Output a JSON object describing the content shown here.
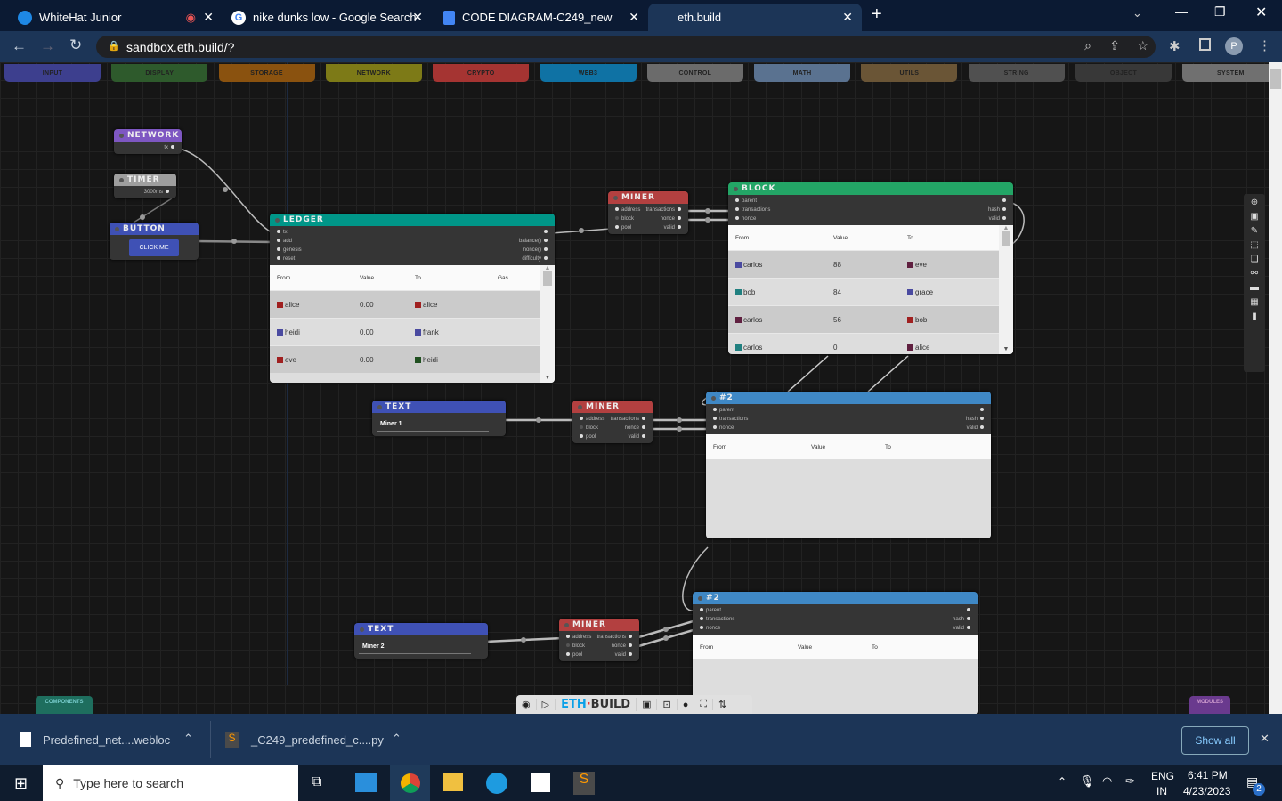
{
  "browser": {
    "tabs": [
      {
        "title": "WhiteHat Junior",
        "icon": "whitehat-icon"
      },
      {
        "title": "nike dunks low - Google Search",
        "icon": "google-icon"
      },
      {
        "title": "CODE DIAGRAM-C249_new",
        "icon": "docs-icon"
      },
      {
        "title": "eth.build",
        "icon": "none"
      }
    ],
    "url": "sandbox.eth.build/?",
    "profile": "P"
  },
  "categories": [
    {
      "label": "INPUT",
      "color": "#3d3f8e"
    },
    {
      "label": "DISPLAY",
      "color": "#2e5a2c"
    },
    {
      "label": "STORAGE",
      "color": "#8a520f"
    },
    {
      "label": "NETWORK",
      "color": "#7d7a17"
    },
    {
      "label": "CRYPTO",
      "color": "#a53432"
    },
    {
      "label": "WEB3",
      "color": "#0f72a4"
    },
    {
      "label": "CONTROL",
      "color": "#6b6b6b"
    },
    {
      "label": "MATH",
      "color": "#5a7290"
    },
    {
      "label": "UTILS",
      "color": "#6a5536"
    },
    {
      "label": "STRING",
      "color": "#505050"
    },
    {
      "label": "OBJECT",
      "color": "#383838"
    },
    {
      "label": "SYSTEM",
      "color": "#707070"
    }
  ],
  "nodes": {
    "network": {
      "title": "NETWORK",
      "color": "#7e57c2",
      "outputs": [
        "tx"
      ]
    },
    "timer": {
      "title": "TIMER",
      "color": "#9e9e9e",
      "outputs": [
        "3000ms"
      ]
    },
    "button": {
      "title": "BUTTON",
      "color": "#3f51b5",
      "button_label": "CLICK ME"
    },
    "ledger": {
      "title": "LEDGER",
      "color": "#009688",
      "inputs": [
        "tx",
        "add",
        "genesis",
        "reset"
      ],
      "outputs": [
        "",
        "balance()",
        "nonce()",
        "difficulty"
      ],
      "columns": [
        "From",
        "Value",
        "To",
        "Gas"
      ],
      "rows": [
        [
          "alice",
          "0.00",
          "alice",
          ""
        ],
        [
          "heidi",
          "0.00",
          "frank",
          ""
        ],
        [
          "eve",
          "0.00",
          "heidi",
          ""
        ]
      ]
    },
    "miner1": {
      "title": "MINER",
      "color": "#b34040",
      "inputs": [
        "address",
        "block",
        "pool"
      ],
      "outputs": [
        "transactions",
        "nonce",
        "valid"
      ]
    },
    "block": {
      "title": "BLOCK",
      "color": "#23a566",
      "inputs": [
        "parent",
        "transactions",
        "nonce"
      ],
      "outputs": [
        "",
        "hash",
        "valid"
      ],
      "columns": [
        "From",
        "Value",
        "To"
      ],
      "rows": [
        [
          "carlos",
          "88",
          "eve"
        ],
        [
          "bob",
          "84",
          "grace"
        ],
        [
          "carlos",
          "56",
          "bob"
        ],
        [
          "carlos",
          "0",
          "alice"
        ]
      ]
    },
    "text1": {
      "title": "TEXT",
      "color": "#3f51b5",
      "value": "Miner 1"
    },
    "miner2": {
      "title": "MINER",
      "color": "#b34040",
      "inputs": [
        "address",
        "block",
        "pool"
      ],
      "outputs": [
        "transactions",
        "nonce",
        "valid"
      ]
    },
    "block2": {
      "title": "#2",
      "color": "#3f88c5",
      "inputs": [
        "parent",
        "transactions",
        "nonce"
      ],
      "outputs": [
        "",
        "hash",
        "valid"
      ],
      "columns": [
        "From",
        "Value",
        "To"
      ],
      "rows": []
    },
    "text2": {
      "title": "TEXT",
      "color": "#3f51b5",
      "value": "Miner 2"
    },
    "miner3": {
      "title": "MINER",
      "color": "#b34040",
      "inputs": [
        "address",
        "block",
        "pool"
      ],
      "outputs": [
        "transactions",
        "nonce",
        "valid"
      ]
    },
    "block3": {
      "title": "#2",
      "color": "#3f88c5",
      "inputs": [
        "parent",
        "transactions",
        "nonce"
      ],
      "outputs": [
        "",
        "hash",
        "valid"
      ],
      "columns": [
        "From",
        "Value",
        "To"
      ],
      "rows": []
    }
  },
  "bottom": {
    "components": "COMPONENTS",
    "modules": "MODULES",
    "logo_eth": "ETH",
    "logo_build": "BUILD"
  },
  "downloads": {
    "items": [
      "Predefined_net....webloc",
      "_C249_predefined_c....py"
    ],
    "show_all": "Show all"
  },
  "taskbar": {
    "search_placeholder": "Type here to search",
    "lang": "ENG",
    "region": "IN",
    "time": "6:41 PM",
    "date": "4/23/2023",
    "notifications": "2"
  }
}
